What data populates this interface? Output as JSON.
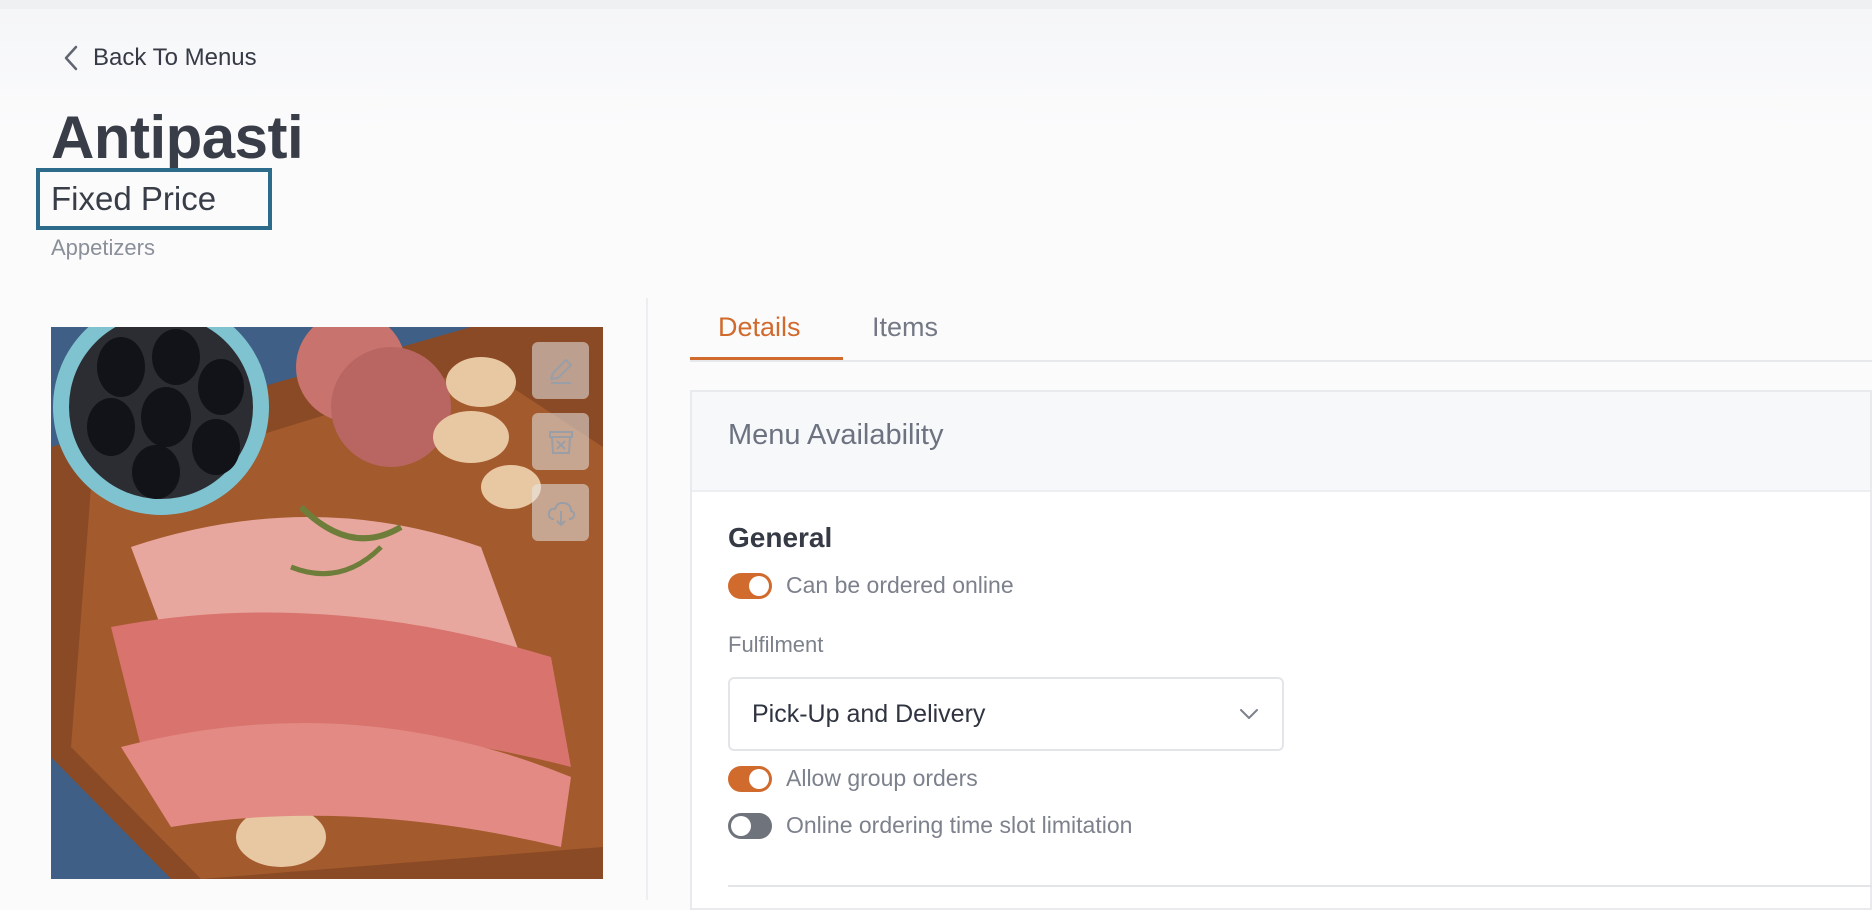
{
  "nav": {
    "back_label": "Back To Menus"
  },
  "menu": {
    "title": "Antipasti",
    "subtitle": "Fixed Price",
    "category": "Appetizers"
  },
  "tabs": [
    {
      "label": "Details",
      "active": true
    },
    {
      "label": "Items",
      "active": false
    }
  ],
  "availability": {
    "header": "Menu Availability",
    "section_title": "General",
    "can_order_online": {
      "label": "Can be ordered online",
      "enabled": true
    },
    "fulfilment": {
      "label": "Fulfilment",
      "value": "Pick-Up and Delivery"
    },
    "group_orders": {
      "label": "Allow group orders",
      "enabled": true
    },
    "time_slot_limit": {
      "label": "Online ordering time slot limitation",
      "enabled": false
    }
  },
  "icons": [
    "chevron-left-icon",
    "edit-icon",
    "delete-icon",
    "cloud-upload-icon",
    "chevron-down-icon"
  ],
  "colors": {
    "accent": "#d16a2d",
    "highlight_box": "#2d6b8b",
    "toggle_off": "#6f737b"
  }
}
